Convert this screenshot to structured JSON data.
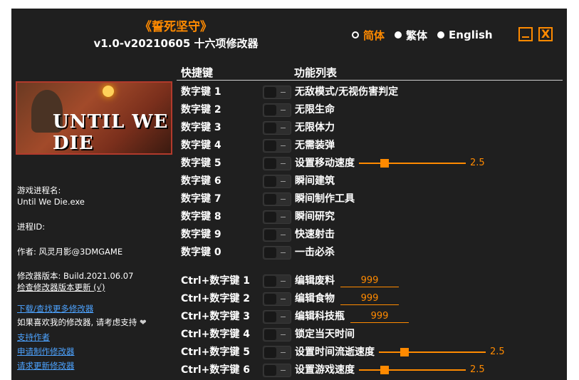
{
  "app": {
    "game_title": "《誓死坚守》",
    "version_line": "v1.0-v20210605 十六项修改器"
  },
  "languages": [
    {
      "label": "简体",
      "selected": true
    },
    {
      "label": "繁体",
      "selected": false
    },
    {
      "label": "English",
      "selected": false
    }
  ],
  "window_buttons": {
    "close_glyph": "X"
  },
  "cover": {
    "logo_text": "UNTIL WE DIE"
  },
  "info": {
    "process_name_label": "游戏进程名:",
    "process_name": "Until We Die.exe",
    "pid_label": "进程ID:",
    "author": "作者: 风灵月影@3DMGAME",
    "trainer_version": "修改器版本: Build.2021.06.07",
    "check_update": "检查修改器版本更新 (√)",
    "download_more": "下载/查找更多修改器",
    "support_prompt": "如果喜欢我的修改器, 请考虑支持",
    "support_author": "支持作者",
    "request_trainer": "申请制作修改器",
    "request_update": "请求更新修改器"
  },
  "headers": {
    "hotkey": "快捷键",
    "function": "功能列表"
  },
  "accent_color": "#ff8a00",
  "rows": [
    {
      "key": "数字键 1",
      "label": "无敌模式/无视伤害判定"
    },
    {
      "key": "数字键 2",
      "label": "无限生命"
    },
    {
      "key": "数字键 3",
      "label": "无限体力"
    },
    {
      "key": "数字键 4",
      "label": "无需装弹"
    },
    {
      "key": "数字键 5",
      "label": "设置移动速度",
      "slider": {
        "value": "2.5",
        "fraction": 0.2
      }
    },
    {
      "key": "数字键 6",
      "label": "瞬间建筑"
    },
    {
      "key": "数字键 7",
      "label": "瞬间制作工具"
    },
    {
      "key": "数字键 8",
      "label": "瞬间研究"
    },
    {
      "key": "数字键 9",
      "label": "快速射击"
    },
    {
      "key": "数字键 0",
      "label": "一击必杀"
    },
    {
      "key": "Ctrl+数字键 1",
      "label": "编辑废料",
      "input": "999"
    },
    {
      "key": "Ctrl+数字键 2",
      "label": "编辑食物",
      "input": "999"
    },
    {
      "key": "Ctrl+数字键 3",
      "label": "编辑科技瓶",
      "input": "999"
    },
    {
      "key": "Ctrl+数字键 4",
      "label": "锁定当天时间"
    },
    {
      "key": "Ctrl+数字键 5",
      "label": "设置时间流逝速度",
      "slider": {
        "value": "2.5",
        "fraction": 0.2
      }
    },
    {
      "key": "Ctrl+数字键 6",
      "label": "设置游戏速度",
      "slider": {
        "value": "2.5",
        "fraction": 0.2
      }
    }
  ]
}
